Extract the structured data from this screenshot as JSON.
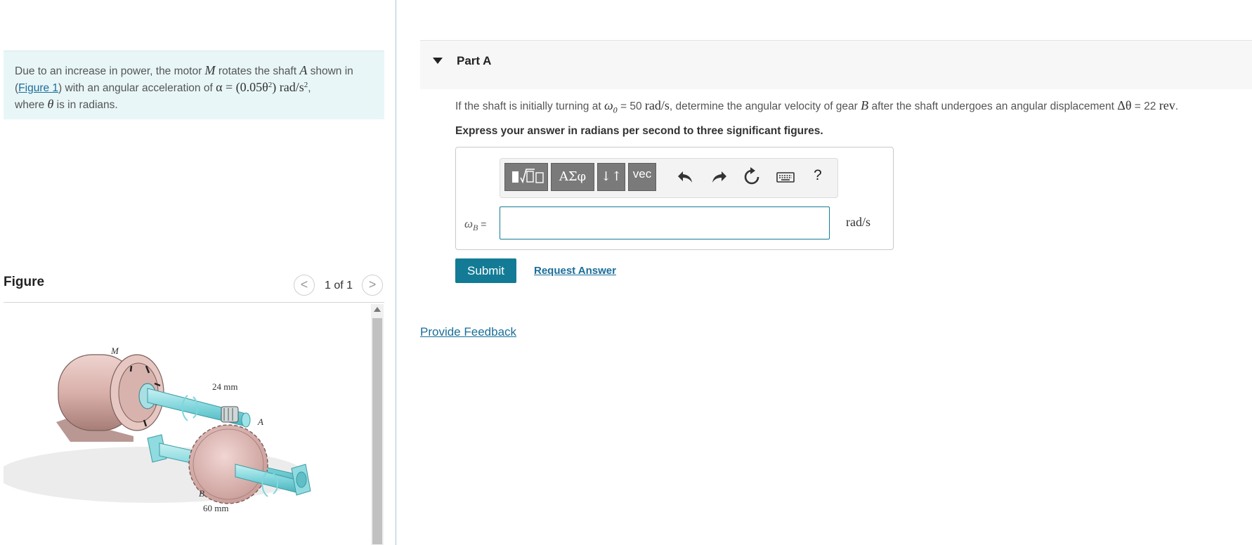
{
  "problem": {
    "text_1": "Due to an increase in power, the motor ",
    "motor_var": "M",
    "text_2": " rotates the shaft ",
    "shaft_var": "A",
    "text_3": " shown in (",
    "figure_link": "Figure 1",
    "text_4": ") with an angular acceleration of ",
    "alpha_lhs": "α = (0.05θ",
    "alpha_exp": "2",
    "alpha_rhs": ") rad/s",
    "alpha_unit_exp": "2",
    "text_5": ",",
    "text_6": "where ",
    "theta_var": "θ",
    "text_7": " is in radians."
  },
  "figure": {
    "title": "Figure",
    "prev_label": "<",
    "next_label": ">",
    "counter": "1 of 1",
    "labels": {
      "motor": "M",
      "pinion_dim": "24 mm",
      "shaft": "A",
      "gear": "B",
      "gear_dim": "60 mm"
    },
    "colors": {
      "motor": "#d9b0aa",
      "shaft": "#7fd6dc",
      "gear": "#d8aeaa"
    }
  },
  "part": {
    "title": "Part A",
    "question_1": "If the shaft is initially turning at ",
    "omega0": "ω",
    "omega0_sub": "0",
    "question_2": " = 50 ",
    "omega0_unit": "rad/s",
    "question_3": ", determine the angular velocity of gear ",
    "gear_var": "B",
    "question_4": " after the shaft undergoes an angular displacement ",
    "delta_theta": "Δθ",
    "question_5": " = 22 ",
    "rev_unit": "rev",
    "question_6": ".",
    "instruction": "Express your answer in radians per second to three significant figures."
  },
  "toolbar": {
    "greek_label": "ΑΣφ",
    "arrows_label": "↓↑",
    "vec_label": "vec",
    "help_label": "?"
  },
  "answer": {
    "var": "ω",
    "var_sub": "B",
    "equals": " =",
    "value": "",
    "unit": "rad/s"
  },
  "actions": {
    "submit_label": "Submit",
    "request_label": "Request Answer",
    "feedback_label": "Provide Feedback"
  }
}
